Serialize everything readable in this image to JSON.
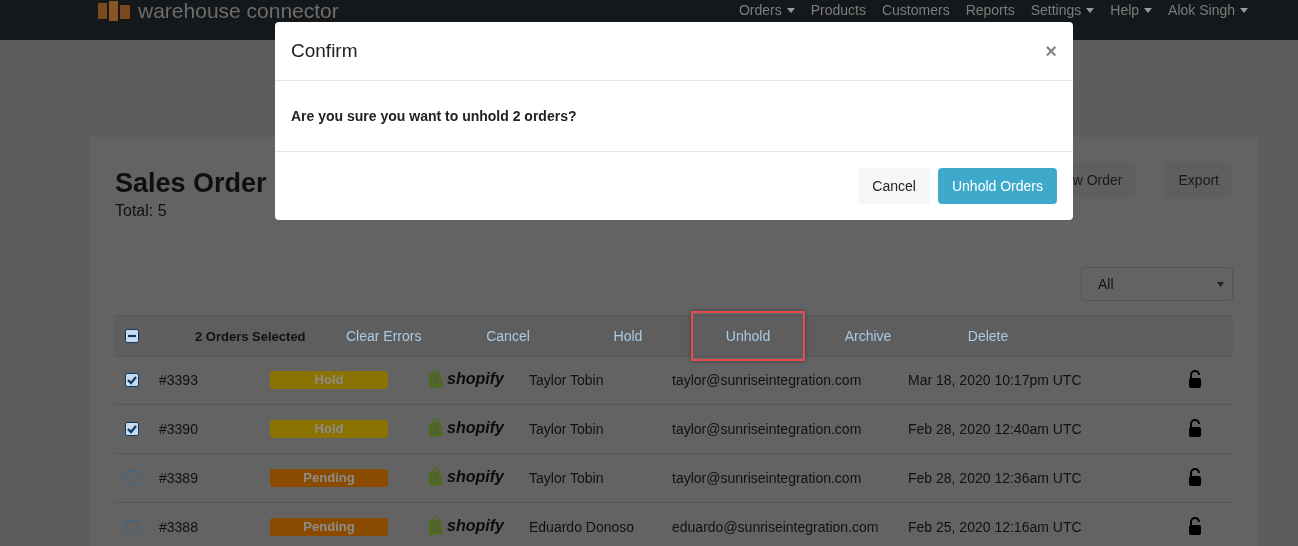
{
  "navbar": {
    "brand": "warehouse connector",
    "items": [
      {
        "label": "Orders",
        "dropdown": true
      },
      {
        "label": "Products",
        "dropdown": false
      },
      {
        "label": "Customers",
        "dropdown": false
      },
      {
        "label": "Reports",
        "dropdown": false
      },
      {
        "label": "Settings",
        "dropdown": true
      },
      {
        "label": "Help",
        "dropdown": true
      },
      {
        "label": "Alok Singh",
        "dropdown": true
      }
    ]
  },
  "page": {
    "title": "Sales Order",
    "total": "Total: 5",
    "buttons": [
      "w Order",
      "Export"
    ],
    "filter": {
      "value": "All"
    }
  },
  "bulk_bar": {
    "indeterminate": true,
    "selected_count": "2 Orders Selected",
    "actions": [
      {
        "label": "Clear Errors",
        "highlighted": false
      },
      {
        "label": "Cancel",
        "highlighted": false
      },
      {
        "label": "Hold",
        "highlighted": false
      },
      {
        "label": "Unhold",
        "highlighted": true
      },
      {
        "label": "Archive",
        "highlighted": false
      },
      {
        "label": "Delete",
        "highlighted": false
      }
    ]
  },
  "orders": [
    {
      "checked": true,
      "number": "#3393",
      "status": "Hold",
      "color": "#8c7200",
      "channel": "shopify",
      "customer": "Taylor Tobin",
      "email": "taylor@sunriseintegration.com",
      "date": "Mar 18, 2020 10:17pm UTC"
    },
    {
      "checked": true,
      "number": "#3390",
      "status": "Hold",
      "color": "#8c7200",
      "channel": "shopify",
      "customer": "Taylor Tobin",
      "email": "taylor@sunriseintegration.com",
      "date": "Feb 28, 2020 12:40am UTC"
    },
    {
      "checked": false,
      "number": "#3389",
      "status": "Pending",
      "color": "#8a4a00",
      "channel": "shopify",
      "customer": "Taylor Tobin",
      "email": "taylor@sunriseintegration.com",
      "date": "Feb 28, 2020 12:36am UTC"
    },
    {
      "checked": false,
      "number": "#3388",
      "status": "Pending",
      "color": "#8a4a00",
      "channel": "shopify",
      "customer": "Eduardo Donoso",
      "email": "eduardo@sunriseintegration.com",
      "date": "Feb 25, 2020 12:16am UTC"
    }
  ],
  "modal": {
    "title": "Confirm",
    "close": "×",
    "message": "Are you sure you want to unhold 2 orders?",
    "buttons": [
      {
        "label": "Cancel",
        "kind": "secondary"
      },
      {
        "label": "Unhold Orders",
        "kind": "primary"
      }
    ]
  }
}
